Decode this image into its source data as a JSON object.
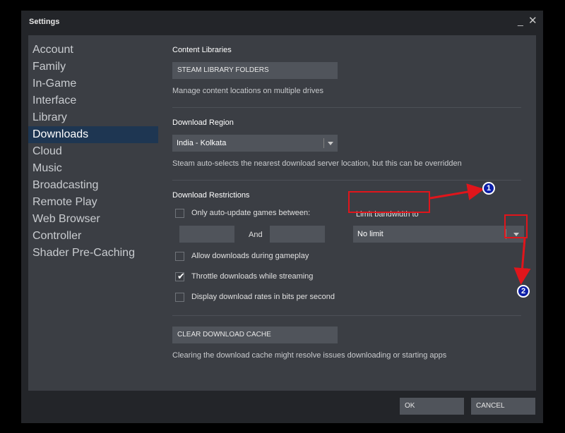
{
  "window": {
    "title": "Settings",
    "minimize_glyph": "_",
    "close_glyph": "✕"
  },
  "sidebar": {
    "items": [
      {
        "label": "Account"
      },
      {
        "label": "Family"
      },
      {
        "label": "In-Game"
      },
      {
        "label": "Interface"
      },
      {
        "label": "Library"
      },
      {
        "label": "Downloads",
        "active": true
      },
      {
        "label": "Cloud"
      },
      {
        "label": "Music"
      },
      {
        "label": "Broadcasting"
      },
      {
        "label": "Remote Play"
      },
      {
        "label": "Web Browser"
      },
      {
        "label": "Controller"
      },
      {
        "label": "Shader Pre-Caching"
      }
    ]
  },
  "content_libraries": {
    "heading": "Content Libraries",
    "button": "STEAM LIBRARY FOLDERS",
    "description": "Manage content locations on multiple drives"
  },
  "download_region": {
    "heading": "Download Region",
    "selected": "India - Kolkata",
    "description": "Steam auto-selects the nearest download server location, but this can be overridden"
  },
  "download_restrictions": {
    "heading": "Download Restrictions",
    "auto_update_label": "Only auto-update games between:",
    "auto_update_checked": false,
    "time_from": "",
    "and_label": "And",
    "time_to": "",
    "bandwidth_label": "Limit bandwidth to",
    "bandwidth_selected": "No limit",
    "options": [
      {
        "label": "Allow downloads during gameplay",
        "checked": false
      },
      {
        "label": "Throttle downloads while streaming",
        "checked": true
      },
      {
        "label": "Display download rates in bits per second",
        "checked": false
      }
    ]
  },
  "cache": {
    "button": "CLEAR DOWNLOAD CACHE",
    "description": "Clearing the download cache might resolve issues downloading or starting apps"
  },
  "footer": {
    "ok": "OK",
    "cancel": "CANCEL"
  },
  "annotations": {
    "badge_1": "1",
    "badge_2": "2",
    "highlight_color": "#e0151b",
    "badge_color": "#0d1fa8"
  },
  "colors": {
    "active_item_bg": "#1e3652",
    "panel_bg": "#3b3e44",
    "window_bg": "#232529"
  }
}
